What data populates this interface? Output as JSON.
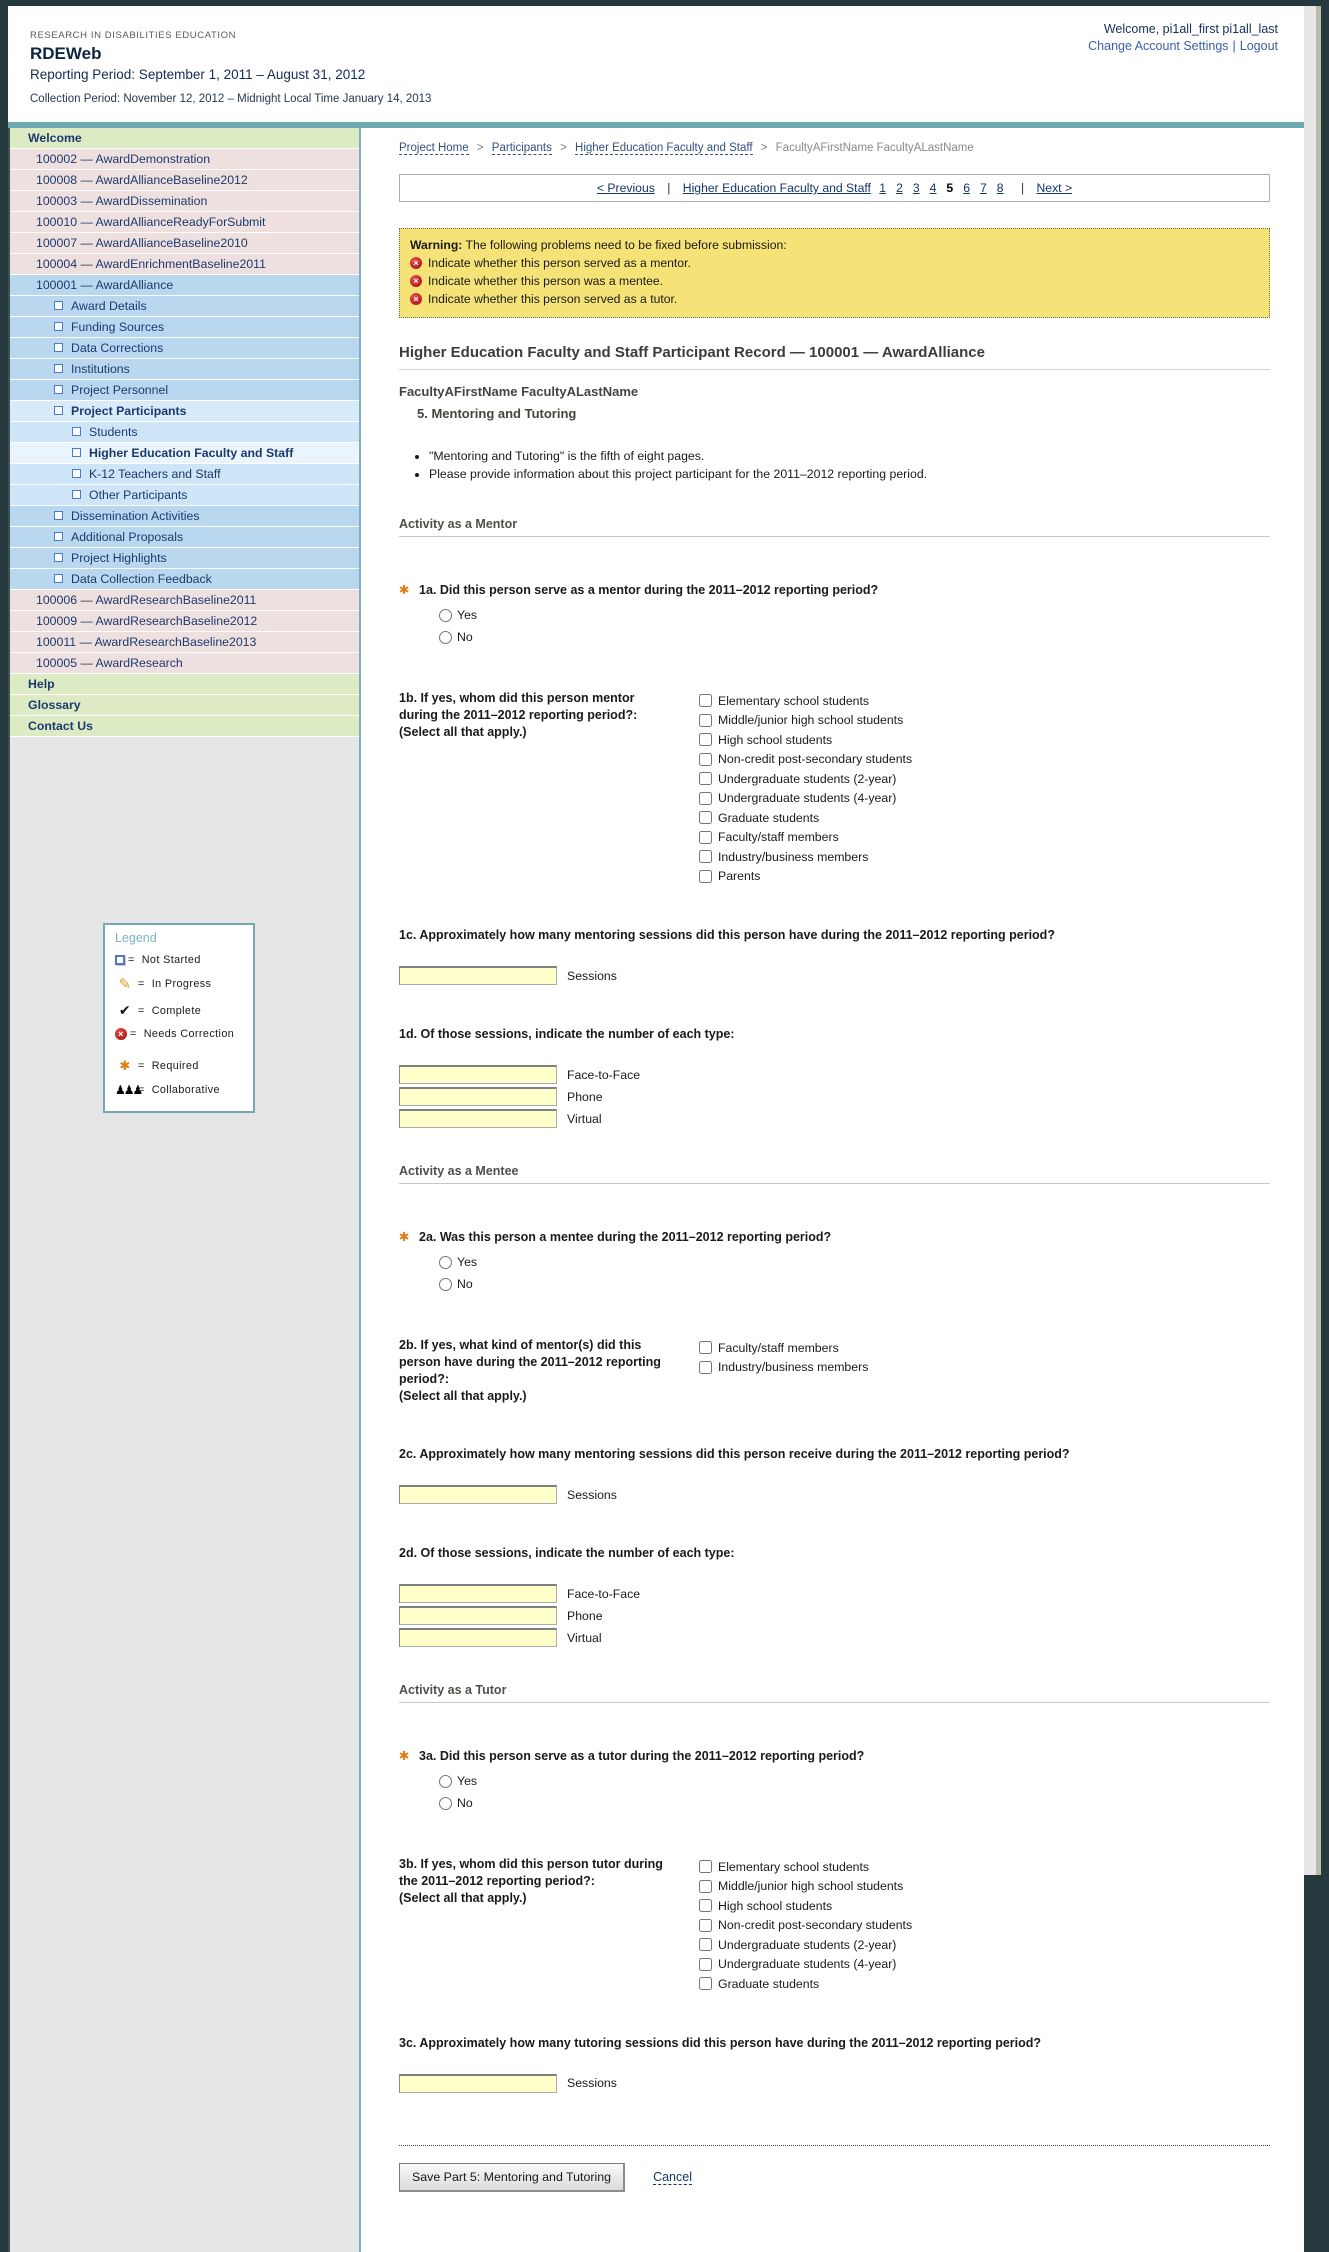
{
  "header": {
    "eyebrow": "RESEARCH IN DISABILITIES EDUCATION",
    "app_title": "RDEWeb",
    "reporting_period": "Reporting Period: September 1, 2011 – August 31, 2012",
    "collection_period": "Collection Period: November 12, 2012 – Midnight Local Time January 14, 2013",
    "welcome": "Welcome, pi1all_first pi1all_last",
    "account_settings_link": "Change Account Settings",
    "link_separator": "|",
    "logout_link": "Logout"
  },
  "sidebar": {
    "items": [
      {
        "label": "Welcome",
        "tone": "green",
        "level": 0
      },
      {
        "label": "100002 — AwardDemonstration",
        "tone": "pink",
        "level": 0
      },
      {
        "label": "100008 — AwardAllianceBaseline2012",
        "tone": "pink",
        "level": 0
      },
      {
        "label": "100003 — AwardDissemination",
        "tone": "pink",
        "level": 0
      },
      {
        "label": "100010 — AwardAllianceReadyForSubmit",
        "tone": "pink",
        "level": 0
      },
      {
        "label": "100007 — AwardAllianceBaseline2010",
        "tone": "pink",
        "level": 0
      },
      {
        "label": "100004 — AwardEnrichmentBaseline2011",
        "tone": "pink",
        "level": 0
      },
      {
        "label": "100001 — AwardAlliance",
        "tone": "blue",
        "level": 0
      },
      {
        "label": "Award Details",
        "tone": "blue",
        "level": 1,
        "checkbox": true
      },
      {
        "label": "Funding Sources",
        "tone": "blue",
        "level": 1,
        "checkbox": true
      },
      {
        "label": "Data Corrections",
        "tone": "blue",
        "level": 1,
        "checkbox": true
      },
      {
        "label": "Institutions",
        "tone": "blue",
        "level": 1,
        "checkbox": true
      },
      {
        "label": "Project Personnel",
        "tone": "blue",
        "level": 1,
        "checkbox": true
      },
      {
        "label": "Project Participants",
        "tone": "blue-open",
        "level": 1,
        "checkbox": true,
        "bold": true
      },
      {
        "label": "Students",
        "tone": "blue-sub",
        "level": 2,
        "checkbox": true
      },
      {
        "label": "Higher Education Faculty and Staff",
        "tone": "blue-selected",
        "level": 2,
        "checkbox": true,
        "bold": true
      },
      {
        "label": "K-12 Teachers and Staff",
        "tone": "blue-sub",
        "level": 2,
        "checkbox": true
      },
      {
        "label": "Other Participants",
        "tone": "blue-sub",
        "level": 2,
        "checkbox": true
      },
      {
        "label": "Dissemination Activities",
        "tone": "blue",
        "level": 1,
        "checkbox": true
      },
      {
        "label": "Additional Proposals",
        "tone": "blue",
        "level": 1,
        "checkbox": true
      },
      {
        "label": "Project Highlights",
        "tone": "blue",
        "level": 1,
        "checkbox": true
      },
      {
        "label": "Data Collection Feedback",
        "tone": "blue",
        "level": 1,
        "checkbox": true
      },
      {
        "label": "100006 — AwardResearchBaseline2011",
        "tone": "pink",
        "level": 0
      },
      {
        "label": "100009 — AwardResearchBaseline2012",
        "tone": "pink",
        "level": 0
      },
      {
        "label": "100011 — AwardResearchBaseline2013",
        "tone": "pink",
        "level": 0
      },
      {
        "label": "100005 — AwardResearch",
        "tone": "pink",
        "level": 0
      },
      {
        "label": "Help",
        "tone": "green",
        "level": 0
      },
      {
        "label": "Glossary",
        "tone": "green",
        "level": 0
      },
      {
        "label": "Contact Us",
        "tone": "green",
        "level": 0
      }
    ],
    "legend": {
      "title": "Legend",
      "equals_sign": "=",
      "rows": [
        {
          "icon": "not-started",
          "label": "Not Started"
        },
        {
          "icon": "in-progress",
          "label": "In Progress"
        },
        {
          "icon": "complete",
          "label": "Complete"
        },
        {
          "icon": "needs-correction",
          "label": "Needs Correction"
        },
        {
          "icon": "required",
          "label": "Required",
          "gap": true
        },
        {
          "icon": "collaborative",
          "label": "Collaborative"
        }
      ]
    }
  },
  "breadcrumb": {
    "separator": ">",
    "items": {
      "0": {
        "label": "Project Home"
      },
      "1": {
        "label": "Participants"
      },
      "2": {
        "label": "Higher Education Faculty and Staff"
      },
      "3": {
        "label": "FacultyAFirstName FacultyALastName"
      }
    }
  },
  "pager": {
    "previous": "< Previous",
    "separator": "|",
    "section_link": "Higher Education Faculty and Staff",
    "pages": [
      {
        "label": "1"
      },
      {
        "label": "2"
      },
      {
        "label": "3"
      },
      {
        "label": "4"
      },
      {
        "label": "5",
        "current": true
      },
      {
        "label": "6"
      },
      {
        "label": "7"
      },
      {
        "label": "8"
      }
    ],
    "next": "Next >"
  },
  "warning": {
    "label": "Warning:",
    "intro": "The following problems need to be fixed before submission:",
    "items": [
      "Indicate whether this person served as a mentor.",
      "Indicate whether this person was a mentee.",
      "Indicate whether this person served as a tutor."
    ]
  },
  "record": {
    "title": "Higher Education Faculty and Staff Participant Record — 100001 — AwardAlliance",
    "participant": "FacultyAFirstName FacultyALastName",
    "page_heading": "5. Mentoring and Tutoring",
    "bullets": [
      "\"Mentoring and Tutoring\" is the fifth of eight pages.",
      "Please provide information about this project participant for the 2011–2012 reporting period."
    ]
  },
  "sections": {
    "mentor": {
      "heading": "Activity as a Mentor",
      "qa": {
        "text": "1a. Did this person serve as a mentor during the 2011–2012 reporting period?",
        "options": [
          "Yes",
          "No"
        ]
      },
      "qb": {
        "text": "1b. If yes, whom did this person mentor during the 2011–2012 reporting period?:",
        "note": "(Select all that apply.)",
        "options": [
          "Elementary school students",
          "Middle/junior high school students",
          "High school students",
          "Non-credit post-secondary students",
          "Undergraduate students (2-year)",
          "Undergraduate students (4-year)",
          "Graduate students",
          "Faculty/staff members",
          "Industry/business members",
          "Parents"
        ]
      },
      "qc": {
        "text": "1c. Approximately how many mentoring sessions did this person have during the 2011–2012 reporting period?",
        "unit": "Sessions"
      },
      "qd": {
        "text": "1d. Of those sessions, indicate the number of each type:",
        "fields": [
          "Face-to-Face",
          "Phone",
          "Virtual"
        ]
      }
    },
    "mentee": {
      "heading": "Activity as a Mentee",
      "qa": {
        "text": "2a. Was this person a mentee during the 2011–2012 reporting period?",
        "options": [
          "Yes",
          "No"
        ]
      },
      "qb": {
        "text": "2b. If yes, what kind of mentor(s) did this person have during the 2011–2012 reporting period?:",
        "note": "(Select all that apply.)",
        "options": [
          "Faculty/staff members",
          "Industry/business members"
        ]
      },
      "qc": {
        "text": "2c. Approximately how many mentoring sessions did this person receive during the 2011–2012 reporting period?",
        "unit": "Sessions"
      },
      "qd": {
        "text": "2d. Of those sessions, indicate the number of each type:",
        "fields": [
          "Face-to-Face",
          "Phone",
          "Virtual"
        ]
      }
    },
    "tutor": {
      "heading": "Activity as a Tutor",
      "qa": {
        "text": "3a. Did this person serve as a tutor during the 2011–2012 reporting period?",
        "options": [
          "Yes",
          "No"
        ]
      },
      "qb": {
        "text": "3b. If yes, whom did this person tutor during the 2011–2012 reporting period?:",
        "note": "(Select all that apply.)",
        "options": [
          "Elementary school students",
          "Middle/junior high school students",
          "High school students",
          "Non-credit post-secondary students",
          "Undergraduate students (2-year)",
          "Undergraduate students (4-year)",
          "Graduate students"
        ]
      },
      "qc": {
        "text": "3c. Approximately how many tutoring sessions did this person have during the 2011–2012 reporting period?",
        "unit": "Sessions"
      }
    }
  },
  "footer": {
    "save_label": "Save Part 5: Mentoring and Tutoring",
    "cancel_label": "Cancel"
  }
}
